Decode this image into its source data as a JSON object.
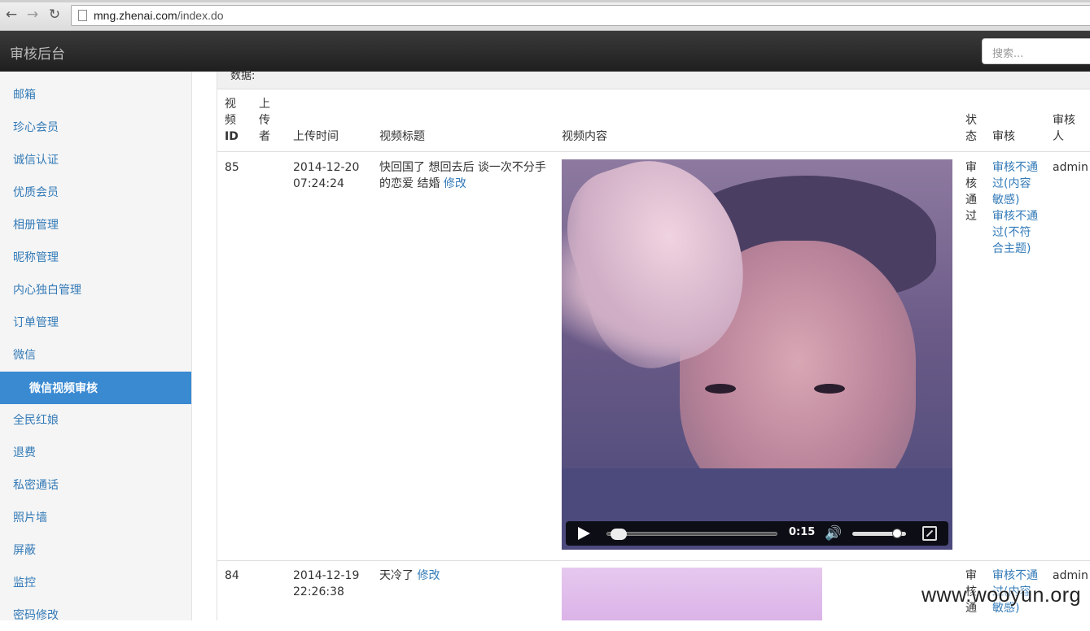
{
  "browser": {
    "url_host": "mng.zhenai.com",
    "url_path": "/index.do"
  },
  "header": {
    "brand": "审核后台",
    "search_placeholder": "搜索..."
  },
  "sidebar": {
    "items": [
      {
        "label": "邮箱"
      },
      {
        "label": "珍心会员"
      },
      {
        "label": "诚信认证"
      },
      {
        "label": "优质会员"
      },
      {
        "label": "相册管理"
      },
      {
        "label": "昵称管理"
      },
      {
        "label": "内心独白管理"
      },
      {
        "label": "订单管理"
      },
      {
        "label": "微信"
      },
      {
        "label": "微信视频审核",
        "active": true
      },
      {
        "label": "全民红娘"
      },
      {
        "label": "退费"
      },
      {
        "label": "私密通话"
      },
      {
        "label": "照片墙"
      },
      {
        "label": "屏蔽"
      },
      {
        "label": "监控"
      },
      {
        "label": "密码修改"
      }
    ]
  },
  "content": {
    "data_label": "数据:",
    "columns": {
      "video_id_1": "视",
      "video_id_2": "频",
      "video_id_3": "ID",
      "uploader_1": "上",
      "uploader_2": "传",
      "uploader_3": "者",
      "upload_time": "上传时间",
      "title": "视频标题",
      "content": "视频内容",
      "status_1": "状",
      "status_2": "态",
      "review": "审核",
      "reviewer_1": "审核",
      "reviewer_2": "人"
    },
    "rows": [
      {
        "id": "85",
        "uploader": "",
        "time_date": "2014-12-20",
        "time_clock": "07:24:24",
        "title_line1": "快回国了 想回去后 谈一次不分手",
        "title_line2": "的恋爱 结婚",
        "edit_label": "修改",
        "status_chars": [
          "审",
          "核",
          "通",
          "过"
        ],
        "reject_sensitive": [
          "审核不通",
          "过(内容",
          "敏感)"
        ],
        "reject_offtopic": [
          "审核不通",
          "过(不符",
          "合主题)"
        ],
        "reviewer": "admin",
        "player": {
          "time": "0:15",
          "progress": 0.02,
          "volume": 0.9
        }
      },
      {
        "id": "84",
        "uploader": "",
        "time_date": "2014-12-19",
        "time_clock": "22:26:38",
        "title_line1": "天冷了",
        "edit_label": "修改",
        "status_chars": [
          "审",
          "核",
          "通"
        ],
        "reject_sensitive": [
          "审核不通",
          "过(内容",
          "敏感)"
        ],
        "reviewer": "admin"
      }
    ]
  },
  "watermark": "www.wooyun.org",
  "icons": {
    "back": "back-arrow-icon",
    "forward": "forward-arrow-icon",
    "reload": "reload-icon",
    "page": "page-icon",
    "play": "play-icon",
    "volume": "volume-icon",
    "fullscreen": "fullscreen-icon"
  }
}
